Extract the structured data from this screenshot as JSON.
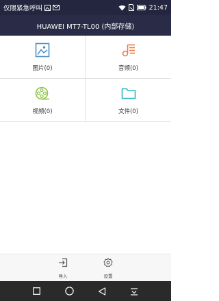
{
  "status_bar": {
    "carrier": "仅限紧急呼叫",
    "time": "21:47",
    "icons": [
      "image-notification-icon",
      "email-notification-icon",
      "wifi-icon",
      "sim-icon",
      "battery-icon"
    ]
  },
  "app_bar": {
    "title": "HUAWEI MT7-TL00 (内部存储)"
  },
  "categories": [
    {
      "label": "图片(0)",
      "icon": "picture-icon",
      "color": "#4a90c8"
    },
    {
      "label": "音频(0)",
      "icon": "music-icon",
      "color": "#f07a3e"
    },
    {
      "label": "视频(0)",
      "icon": "video-icon",
      "color": "#8cc63f"
    },
    {
      "label": "文件(0)",
      "icon": "folder-icon",
      "color": "#31b3c9"
    }
  ],
  "toolbar": {
    "import_label": "导入",
    "settings_label": "设置"
  },
  "nav_bar": {
    "icons": [
      "recent-apps-icon",
      "home-icon",
      "back-icon",
      "notification-shade-icon"
    ]
  }
}
